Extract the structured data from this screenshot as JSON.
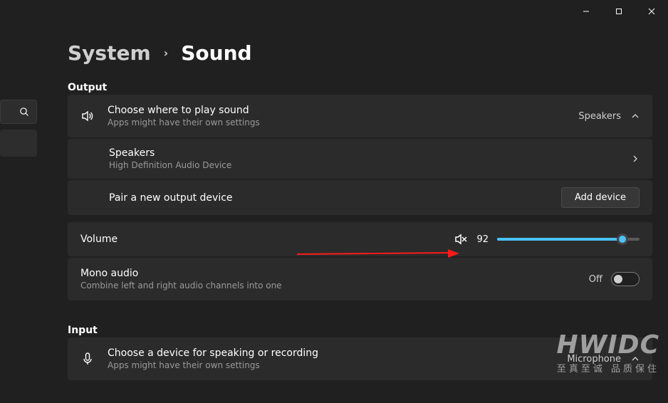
{
  "breadcrumb": {
    "system": "System",
    "current": "Sound"
  },
  "sections": {
    "output": "Output",
    "input": "Input"
  },
  "output": {
    "choose": {
      "title": "Choose where to play sound",
      "sub": "Apps might have their own settings",
      "value": "Speakers"
    },
    "device": {
      "title": "Speakers",
      "sub": "High Definition Audio Device"
    },
    "pair": {
      "title": "Pair a new output device",
      "button": "Add device"
    },
    "volume": {
      "title": "Volume",
      "value": "92"
    },
    "mono": {
      "title": "Mono audio",
      "sub": "Combine left and right audio channels into one",
      "state": "Off"
    }
  },
  "input": {
    "choose": {
      "title": "Choose a device for speaking or recording",
      "sub": "Apps might have their own settings",
      "value": "Microphone"
    }
  },
  "watermark": {
    "big": "HWIDC",
    "small": "至真至诚  品质保住"
  }
}
